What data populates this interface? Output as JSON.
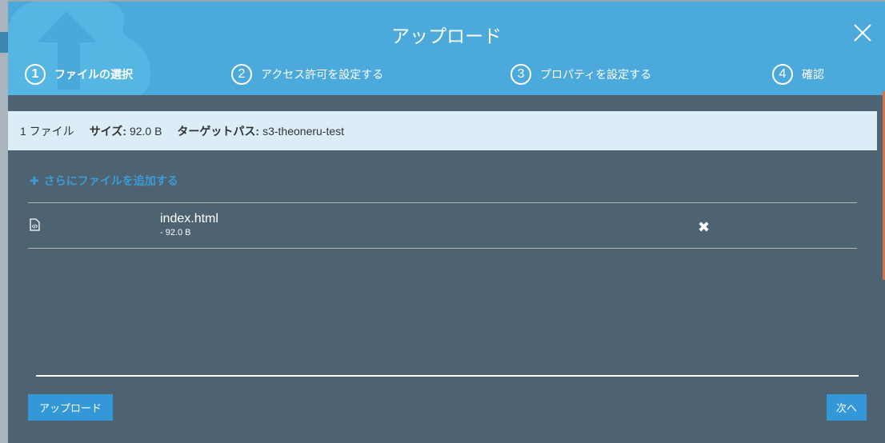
{
  "modal": {
    "title": "アップロード"
  },
  "steps": [
    {
      "num": "1",
      "label": "ファイルの選択"
    },
    {
      "num": "2",
      "label": "アクセス許可を設定する"
    },
    {
      "num": "3",
      "label": "プロパティを設定する"
    },
    {
      "num": "4",
      "label": "確認"
    }
  ],
  "summary": {
    "count": "1 ファイル",
    "size_label": "サイズ:",
    "size": "92.0 B",
    "target_label": "ターゲットパス:",
    "target": "s3-theoneru-test"
  },
  "add_files": "さらにファイルを追加する",
  "files": [
    {
      "name": "index.html",
      "size": "- 92.0 B"
    }
  ],
  "buttons": {
    "upload": "アップロード",
    "next": "次へ"
  },
  "colors": {
    "header": "#4ba9dc",
    "body": "#4e6371",
    "accent": "#3498d8"
  }
}
